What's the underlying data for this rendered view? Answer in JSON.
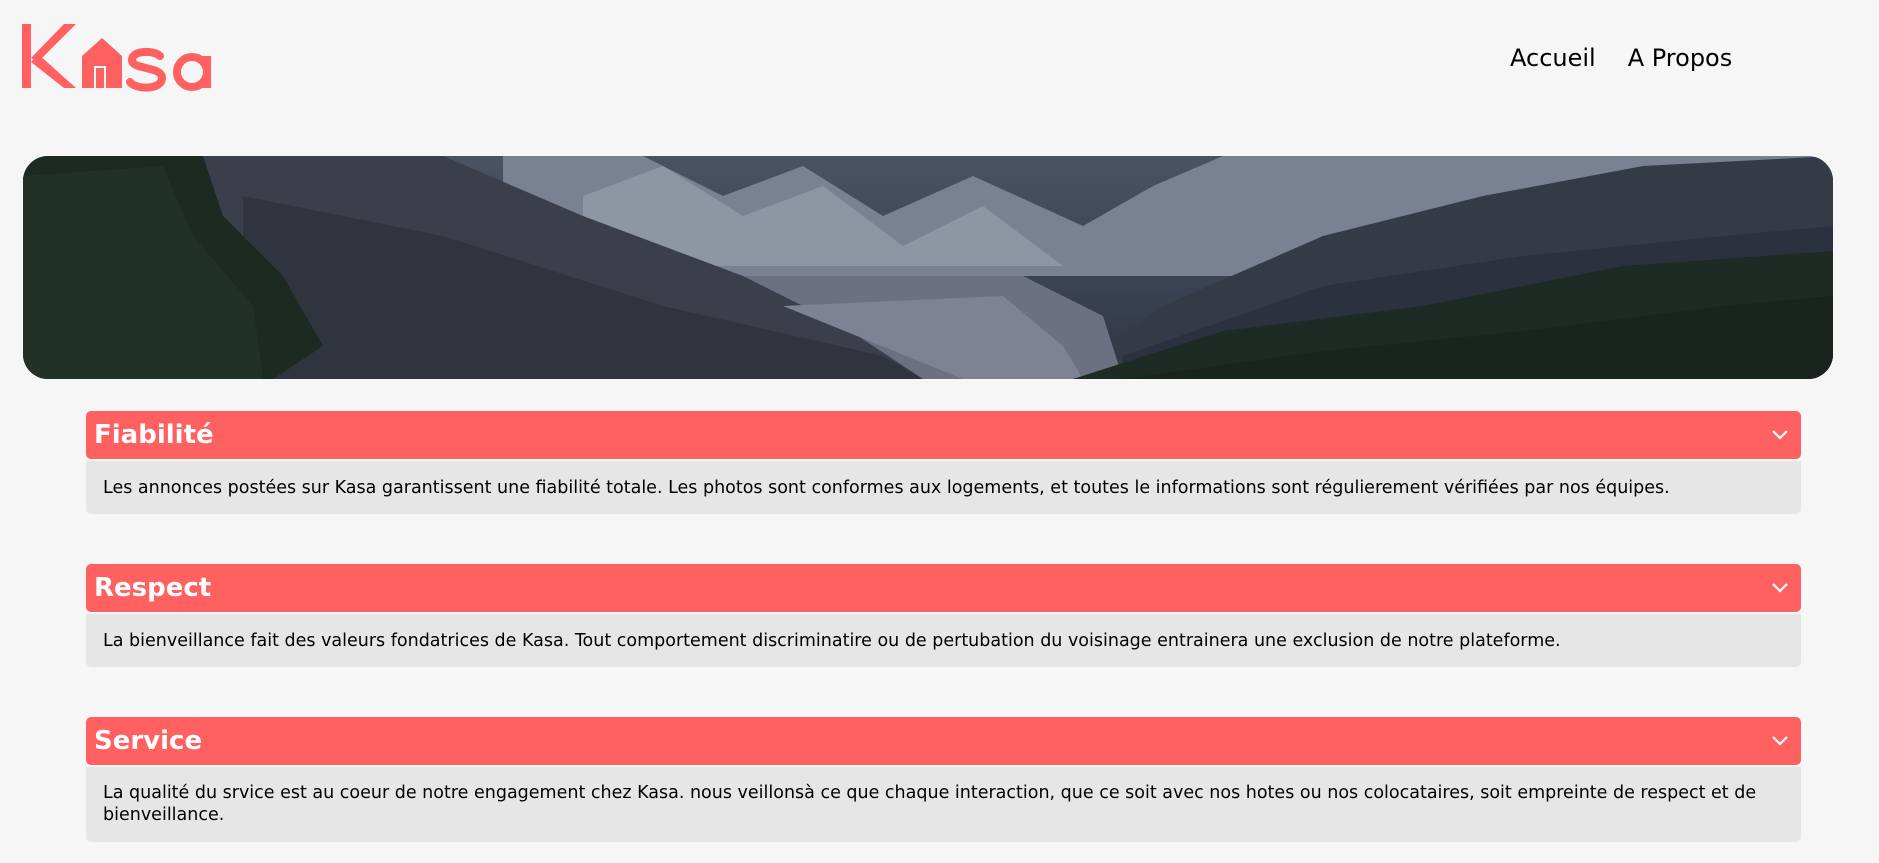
{
  "brand": {
    "logo_text": "Kasa",
    "accent_color": "#ff6060"
  },
  "nav": {
    "home_label": "Accueil",
    "about_label": "A Propos"
  },
  "banner": {
    "description": "mountain-valley-image"
  },
  "sections": [
    {
      "title": "Fiabilité",
      "body": "Les annonces postées sur Kasa garantissent une fiabilité totale. Les photos sont conformes aux logements, et toutes le informations sont régulierement vérifiées par nos équipes.",
      "icon": "chevron-down-icon"
    },
    {
      "title": "Respect",
      "body": "La bienveillance fait des valeurs fondatrices de Kasa. Tout comportement discriminatire ou de pertubation du voisinage entrainera une exclusion de notre plateforme.",
      "icon": "chevron-down-icon"
    },
    {
      "title": "Service",
      "body": "La qualité du srvice est au coeur de notre engagement chez Kasa. nous veillonsà ce que chaque interaction, que ce soit avec nos hotes ou nos colocataires, soit empreinte de respect et de bienveillance.",
      "icon": "chevron-down-icon"
    }
  ]
}
